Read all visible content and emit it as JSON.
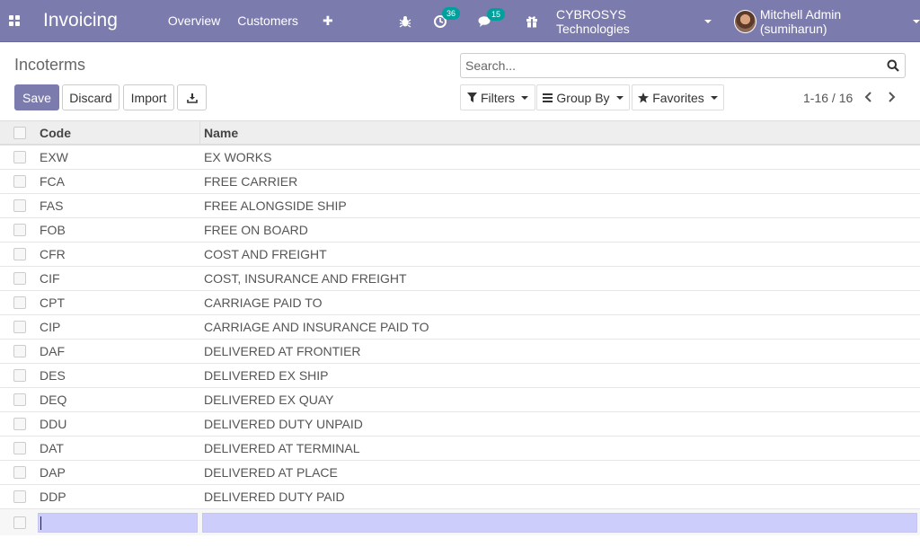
{
  "navbar": {
    "app_name": "Invoicing",
    "menu": [
      "Overview",
      "Customers"
    ],
    "plus": "✚",
    "activity_badge": "36",
    "messages_badge": "15",
    "company": "CYBROSYS Technologies",
    "user": "Mitchell Admin (sumiharun)",
    "accent_color": "#7c7bad"
  },
  "breadcrumb": "Incoterms",
  "search": {
    "placeholder": "Search..."
  },
  "buttons": {
    "save": "Save",
    "discard": "Discard",
    "import": "Import"
  },
  "filters": {
    "filters": "Filters",
    "group_by": "Group By",
    "favorites": "Favorites"
  },
  "pager": {
    "value": "1-16 / 16"
  },
  "table": {
    "columns": {
      "code": "Code",
      "name": "Name"
    },
    "rows": [
      {
        "code": "EXW",
        "name": "EX WORKS"
      },
      {
        "code": "FCA",
        "name": "FREE CARRIER"
      },
      {
        "code": "FAS",
        "name": "FREE ALONGSIDE SHIP"
      },
      {
        "code": "FOB",
        "name": "FREE ON BOARD"
      },
      {
        "code": "CFR",
        "name": "COST AND FREIGHT"
      },
      {
        "code": "CIF",
        "name": "COST, INSURANCE AND FREIGHT"
      },
      {
        "code": "CPT",
        "name": "CARRIAGE PAID TO"
      },
      {
        "code": "CIP",
        "name": "CARRIAGE AND INSURANCE PAID TO"
      },
      {
        "code": "DAF",
        "name": "DELIVERED AT FRONTIER"
      },
      {
        "code": "DES",
        "name": "DELIVERED EX SHIP"
      },
      {
        "code": "DEQ",
        "name": "DELIVERED EX QUAY"
      },
      {
        "code": "DDU",
        "name": "DELIVERED DUTY UNPAID"
      },
      {
        "code": "DAT",
        "name": "DELIVERED AT TERMINAL"
      },
      {
        "code": "DAP",
        "name": "DELIVERED AT PLACE"
      },
      {
        "code": "DDP",
        "name": "DELIVERED DUTY PAID"
      }
    ]
  }
}
